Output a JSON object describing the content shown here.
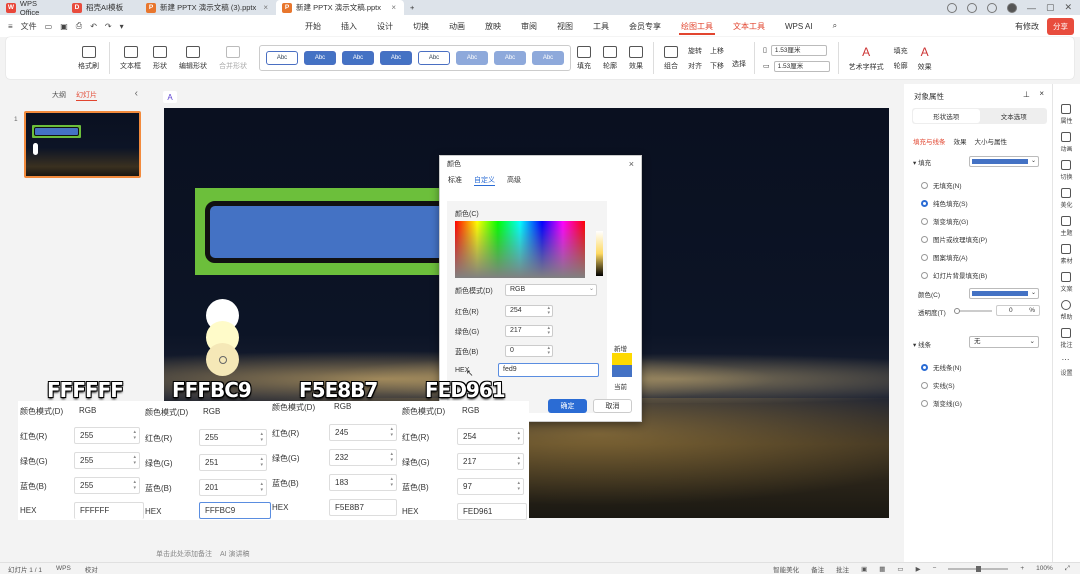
{
  "titlebar": {
    "tabs": [
      {
        "label": "WPS Office",
        "badge": "W",
        "color": "#e8463a"
      },
      {
        "label": "稻壳AI模板",
        "badge": "D",
        "color": "#e84c3d"
      },
      {
        "label": "新建 PPTX 演示文稿 (3).pptx",
        "badge": "P",
        "color": "#e8762d"
      },
      {
        "label": "新建 PPTX 演示文稿.pptx",
        "badge": "P",
        "color": "#e8762d"
      }
    ],
    "new_tab": "+"
  },
  "menubar": {
    "file": "文件",
    "tabs": [
      "开始",
      "插入",
      "设计",
      "切换",
      "动画",
      "放映",
      "审阅",
      "视图",
      "工具",
      "会员专享",
      "绘图工具",
      "文本工具",
      "WPS AI"
    ],
    "active_tab": "绘图工具",
    "has_changes": "有修改",
    "share": "分享"
  },
  "ribbon": {
    "format_painter": "格式刷",
    "text_box": "文本框",
    "shape": "形状",
    "edit_shape": "编辑形状",
    "merge_shape": "合并形状",
    "style_label": "Abc",
    "fill": "填充",
    "outline": "轮廓",
    "effect": "效果",
    "combine": "组合",
    "align": "对齐",
    "rotate": "旋转",
    "bring_up": "上移",
    "send_down": "下移",
    "select": "选择",
    "height": "1.53厘米",
    "width": "1.53厘米",
    "art_text": "艺术字样式",
    "text_fill": "填充",
    "text_outline": "轮廓",
    "text_effect": "效果"
  },
  "left_panel": {
    "outline_tab": "大纲",
    "slides_tab": "幻灯片",
    "slide_number": "1"
  },
  "color_dialog": {
    "title": "颜色",
    "tabs": [
      "标准",
      "自定义",
      "高级"
    ],
    "active_tab": "自定义",
    "colors_label": "颜色(C)",
    "mode_label": "颜色模式(D)",
    "mode_value": "RGB",
    "red_label": "红色(R)",
    "red": "254",
    "green_label": "绿色(G)",
    "green": "217",
    "blue_label": "蓝色(B)",
    "blue": "0",
    "hex_label": "HEX",
    "hex": "fed9",
    "new_label": "新增",
    "current_label": "当前",
    "new_color": "#fed900",
    "current_color": "#4472c4",
    "ok": "确定",
    "cancel": "取消"
  },
  "overlays": [
    {
      "title": "FFFFFF",
      "mode_label": "颜色模式(D)",
      "mode": "RGB",
      "r_label": "红色(R)",
      "r": "255",
      "g_label": "绿色(G)",
      "g": "255",
      "b_label": "蓝色(B)",
      "b": "255",
      "hex_label": "HEX",
      "hex": "FFFFFF"
    },
    {
      "title": "FFFBC9",
      "mode_label": "颜色模式(D)",
      "mode": "RGB",
      "r_label": "红色(R)",
      "r": "255",
      "g_label": "绿色(G)",
      "g": "251",
      "b_label": "蓝色(B)",
      "b": "201",
      "hex_label": "HEX",
      "hex": "FFFBC9"
    },
    {
      "title": "F5E8B7",
      "mode_label": "颜色模式(D)",
      "mode": "RGB",
      "r_label": "红色(R)",
      "r": "245",
      "g_label": "绿色(G)",
      "g": "232",
      "b_label": "蓝色(B)",
      "b": "183",
      "hex_label": "HEX",
      "hex": "F5E8B7"
    },
    {
      "title": "FED961",
      "mode_label": "颜色模式(D)",
      "mode": "RGB",
      "r_label": "红色(R)",
      "r": "254",
      "g_label": "绿色(G)",
      "g": "217",
      "b_label": "蓝色(B)",
      "b": "97",
      "hex_label": "HEX",
      "hex": "FED961"
    }
  ],
  "right_panel": {
    "title": "对象属性",
    "tab_shape": "形状选项",
    "tab_text": "文本选项",
    "sub_fill_line": "填充与线条",
    "sub_effect": "效果",
    "sub_size": "大小与属性",
    "fill_header": "填充",
    "fill_options": [
      "无填充(N)",
      "纯色填充(S)",
      "渐变填充(G)",
      "图片或纹理填充(P)",
      "图案填充(A)",
      "幻灯片背景填充(B)"
    ],
    "color_label": "颜色(C)",
    "transparency_label": "透明度(T)",
    "transparency_value": "0",
    "transparency_unit": "%",
    "line_header": "线条",
    "line_value": "无",
    "line_options": [
      "无线条(N)",
      "实线(S)",
      "渐变线(G)"
    ],
    "accent": "#4472c4"
  },
  "rail": [
    "属性",
    "动画",
    "切换",
    "美化",
    "主题",
    "素材",
    "文案",
    "帮助",
    "批注",
    "设置"
  ],
  "notes": {
    "placeholder": "单击此处添加备注",
    "ai": "AI 演讲稿"
  },
  "status": {
    "slide": "幻灯片 1 / 1",
    "theme": "WPS",
    "proof": "校对",
    "beautify": "智能美化",
    "notes": "备注",
    "comment": "批注",
    "zoom": "100%"
  }
}
